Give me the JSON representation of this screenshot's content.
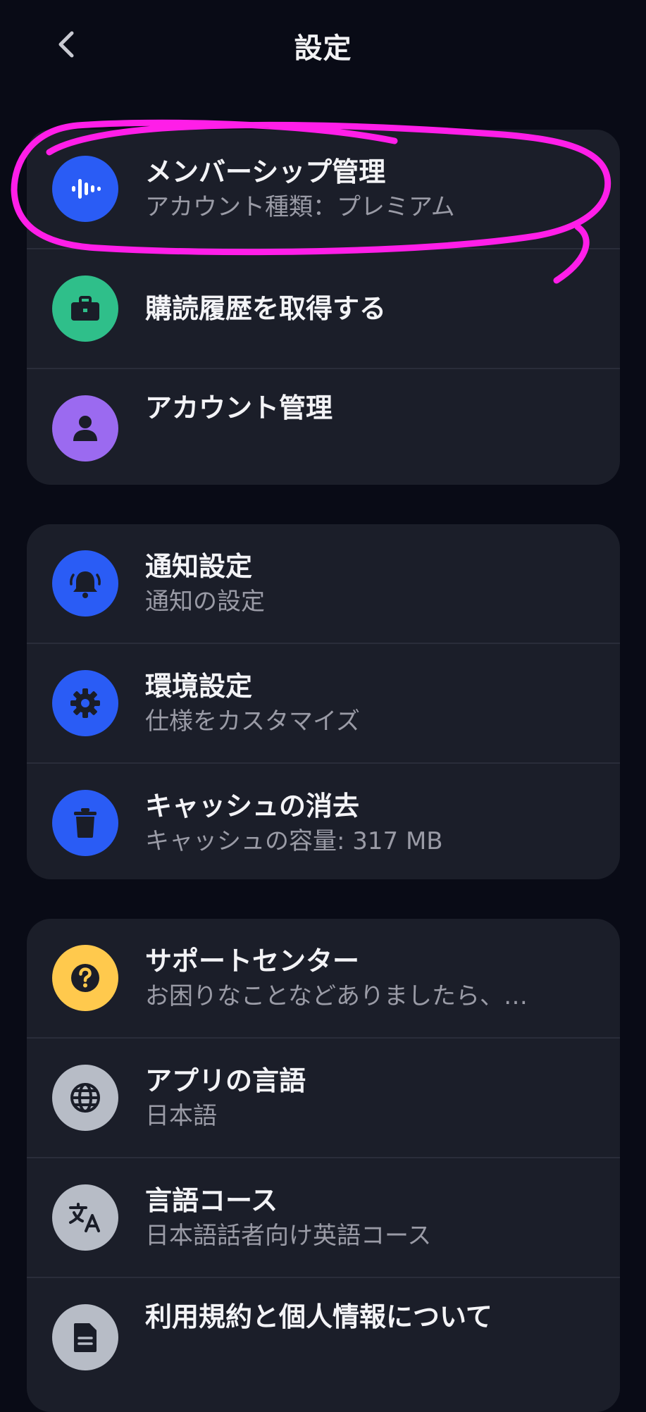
{
  "header": {
    "title": "設定"
  },
  "colors": {
    "background": "#090b16",
    "card": "#1b1e29",
    "blue": "#2a5cf5",
    "green": "#2fbf8a",
    "purple": "#9b6af0",
    "yellow": "#ffc94d",
    "gray": "#b7bcc6",
    "annotation": "#ff1ee8"
  },
  "groups": [
    {
      "items": [
        {
          "title": "メンバーシップ管理",
          "subtitle": "アカウント種類：プレミアム",
          "icon": "audio-wave-icon"
        },
        {
          "title": "購読履歴を取得する",
          "subtitle": "",
          "icon": "briefcase-icon"
        },
        {
          "title": "アカウント管理",
          "subtitle": "",
          "icon": "person-icon"
        }
      ]
    },
    {
      "items": [
        {
          "title": "通知設定",
          "subtitle": "通知の設定",
          "icon": "bell-icon"
        },
        {
          "title": "環境設定",
          "subtitle": "仕様をカスタマイズ",
          "icon": "gear-icon"
        },
        {
          "title": "キャッシュの消去",
          "subtitle": "キャッシュの容量: 317 MB",
          "icon": "trash-icon"
        }
      ]
    },
    {
      "items": [
        {
          "title": "サポートセンター",
          "subtitle": "お困りなことなどありましたら、…",
          "icon": "question-icon"
        },
        {
          "title": "アプリの言語",
          "subtitle": "日本語",
          "icon": "globe-icon"
        },
        {
          "title": "言語コース",
          "subtitle": "日本語話者向け英語コース",
          "icon": "translate-icon"
        },
        {
          "title": "利用規約と個人情報について",
          "subtitle": "",
          "icon": "document-icon"
        }
      ]
    }
  ]
}
